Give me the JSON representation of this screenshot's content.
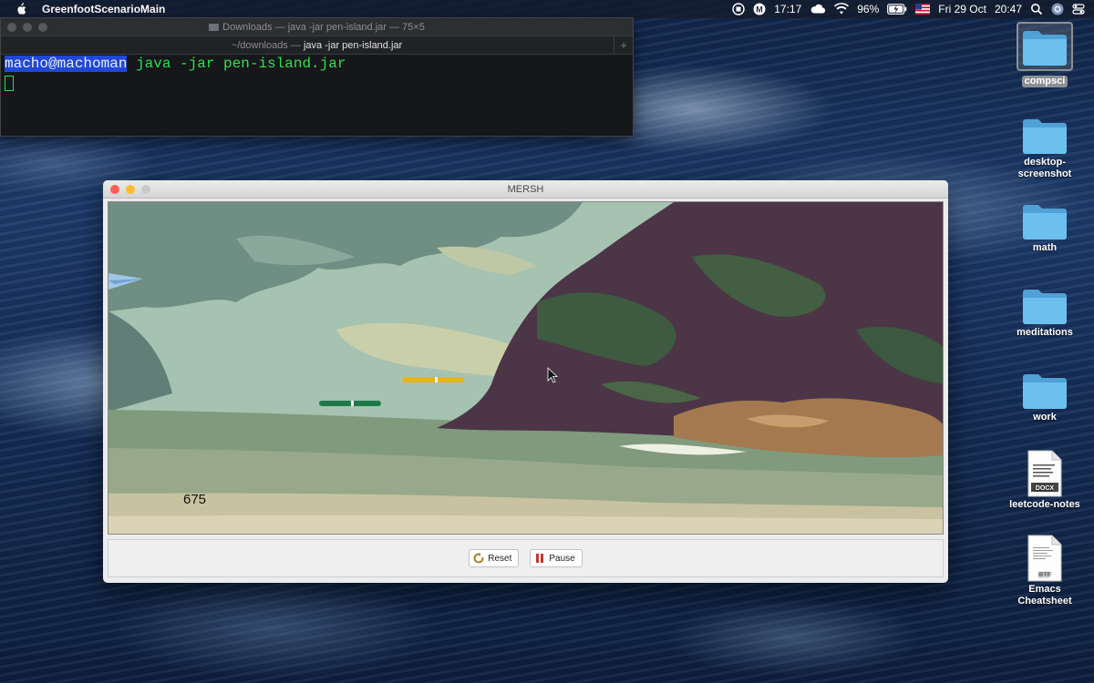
{
  "menubar": {
    "app_name": "GreenfootScenarioMain",
    "clock_small": "17:17",
    "battery": "96%",
    "date": "Fri 29 Oct",
    "time": "20:47",
    "icons": [
      "apple-icon",
      "record-icon",
      "malwarebytes-icon",
      "icloud-icon",
      "wifi-icon",
      "battery-icon",
      "flag-icon",
      "search-icon",
      "siri-icon",
      "control-center-icon"
    ]
  },
  "terminal": {
    "title": "Downloads — java -jar pen-island.jar — 75×5",
    "tab_dir": "~/downloads —",
    "tab_cmd": "java -jar pen-island.jar",
    "prompt": "macho@machoman",
    "command": " java -jar pen-island.jar"
  },
  "game": {
    "title": "MERSH",
    "score": "675",
    "reset_label": "Reset",
    "pause_label": "Pause"
  },
  "desktop": {
    "items": [
      {
        "label": "compsci",
        "kind": "folder",
        "selected": true
      },
      {
        "label": "desktop-\nscreenshot",
        "kind": "folder",
        "selected": false
      },
      {
        "label": "math",
        "kind": "folder",
        "selected": false
      },
      {
        "label": "meditations",
        "kind": "folder",
        "selected": false
      },
      {
        "label": "work",
        "kind": "folder",
        "selected": false
      },
      {
        "label": "leetcode-notes",
        "kind": "docx",
        "badge": "DOCX",
        "selected": false
      },
      {
        "label": "Emacs Cheatsheet",
        "kind": "rtf",
        "badge": "RTF",
        "selected": false
      }
    ]
  },
  "colors": {
    "prompt_highlight": "#2147d8",
    "terminal_text": "#2ee04a",
    "folder_blue": "#5fb3e6"
  }
}
